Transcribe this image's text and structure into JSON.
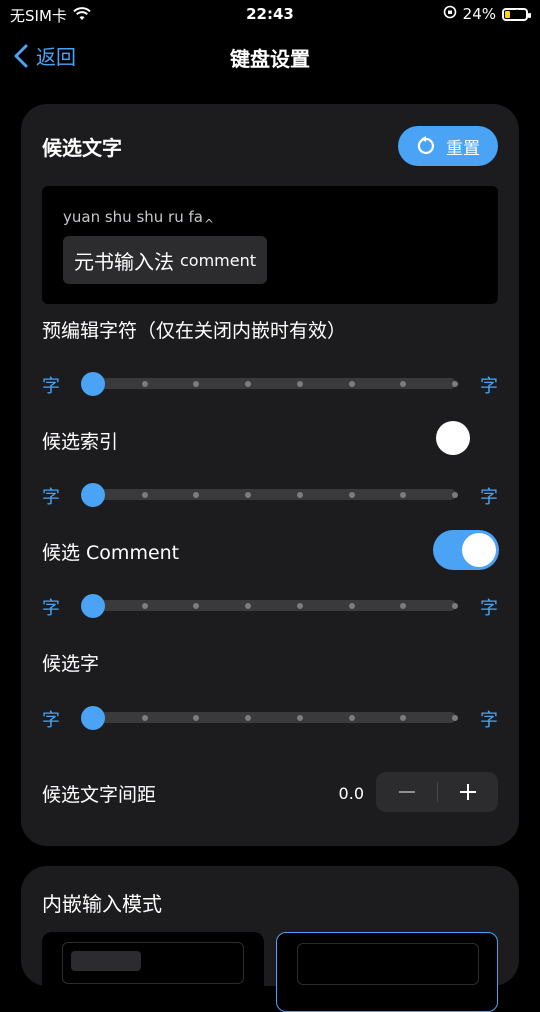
{
  "status": {
    "carrier": "无SIM卡",
    "time": "22:43",
    "battery": "24%",
    "battery_level": 0.24
  },
  "nav": {
    "back_label": "返回",
    "title": "键盘设置"
  },
  "candidate_section": {
    "title": "候选文字",
    "reset_label": "重置",
    "preview": {
      "pinyin": "yuan shu shu ru fa",
      "candidate_text": "元书输入法",
      "candidate_comment": "comment"
    },
    "preedit_label": "预编辑字符（仅在关闭内嵌时有效）",
    "index_label": "候选索引",
    "index_enabled": false,
    "comment_label": "候选 Comment",
    "comment_enabled": true,
    "candidate_char_label": "候选字",
    "slider_char": "字",
    "slider_levels": 8,
    "slider_values": {
      "preedit": 0,
      "index": 0,
      "comment": 0,
      "candidate": 0
    },
    "spacing_label": "候选文字间距",
    "spacing_value": "0.0"
  },
  "inline_mode": {
    "title": "内嵌输入模式"
  },
  "colors": {
    "accent": "#4aa3f5",
    "card": "#1c1c1e",
    "background": "#000000"
  }
}
